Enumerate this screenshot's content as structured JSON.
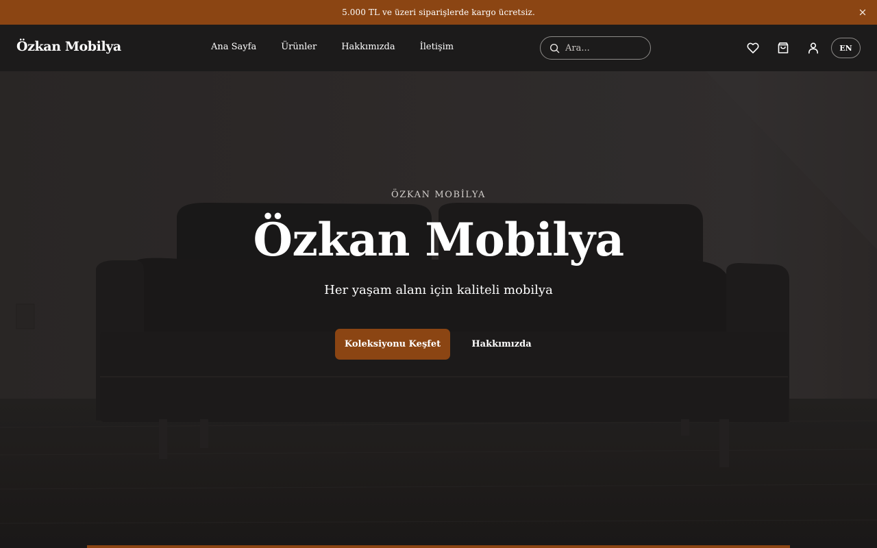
{
  "promo": {
    "text": "5.000 TL ve üzeri siparişlerde kargo ücretsiz.",
    "close_icon": "close-icon"
  },
  "header": {
    "logo": "Özkan Mobilya",
    "nav": [
      {
        "label": "Ana Sayfa"
      },
      {
        "label": "Ürünler"
      },
      {
        "label": "Hakkımızda"
      },
      {
        "label": "İletişim"
      }
    ],
    "search": {
      "placeholder": "Ara...",
      "value": "",
      "icon": "search-icon"
    },
    "icons": [
      "heart-icon",
      "shopping-bag-icon",
      "user-icon"
    ],
    "language": "EN"
  },
  "hero": {
    "eyebrow": "ÖZKAN MOBİLYA",
    "title": "Özkan Mobilya",
    "subtitle": "Her yaşam alanı için kaliteli mobilya",
    "primary_cta": "Koleksiyonu Keşfet",
    "secondary_cta": "Hakkımızda"
  },
  "colors": {
    "accent": "#8b4513",
    "navbar": "#1c1b1b",
    "hero_overlay": "#2a2625",
    "text": "#ffffff"
  }
}
